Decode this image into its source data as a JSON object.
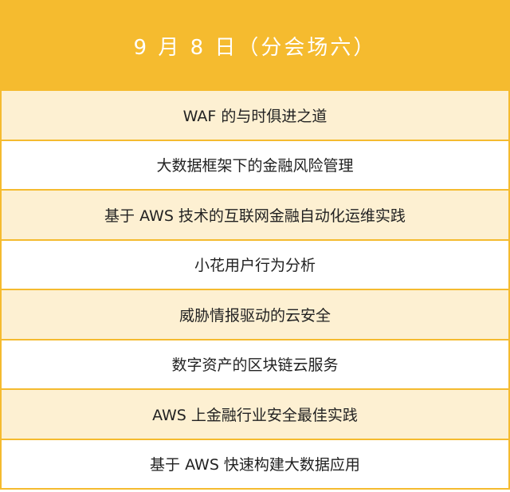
{
  "header": {
    "title": "9 月 8 日（分会场六）"
  },
  "sessions": [
    "WAF 的与时俱进之道",
    "大数据框架下的金融风险管理",
    "基于 AWS 技术的互联网金融自动化运维实践",
    "小花用户行为分析",
    "威胁情报驱动的云安全",
    "数字资产的区块链云服务",
    "AWS 上金融行业安全最佳实践",
    "基于 AWS 快速构建大数据应用"
  ],
  "colors": {
    "header_bg": "#f5bb2f",
    "row_alt_bg": "#fdf0d2",
    "row_bg": "#ffffff",
    "border": "#f5bb2f"
  }
}
